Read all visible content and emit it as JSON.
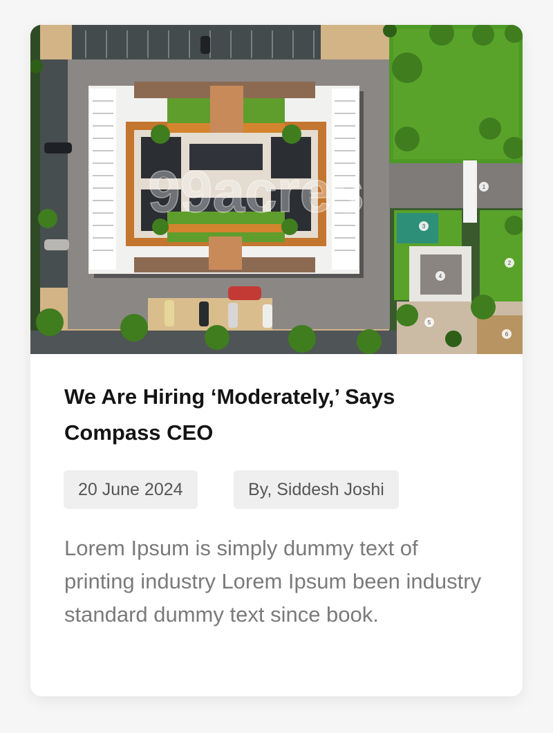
{
  "card": {
    "image": {
      "watermark": "99acres",
      "plot_numbers": [
        "1",
        "2",
        "3",
        "4",
        "5",
        "6"
      ]
    },
    "title": "We Are Hiring ‘Moderately,’ Says Compass CEO",
    "date": "20 June 2024",
    "author": "By, Siddesh Joshi",
    "description": "Lorem Ipsum is simply dummy text of printing industry Lorem Ipsum been industry standard dummy text since book."
  },
  "colors": {
    "page_background": "#f6f6f6",
    "card_background": "#ffffff",
    "title": "#141414",
    "chip_background": "#efefef",
    "chip_text": "#565656",
    "description": "#7a7a7a",
    "lawn": "#5aa32a",
    "roof": "#c98a5a",
    "road": "#8b8785"
  }
}
